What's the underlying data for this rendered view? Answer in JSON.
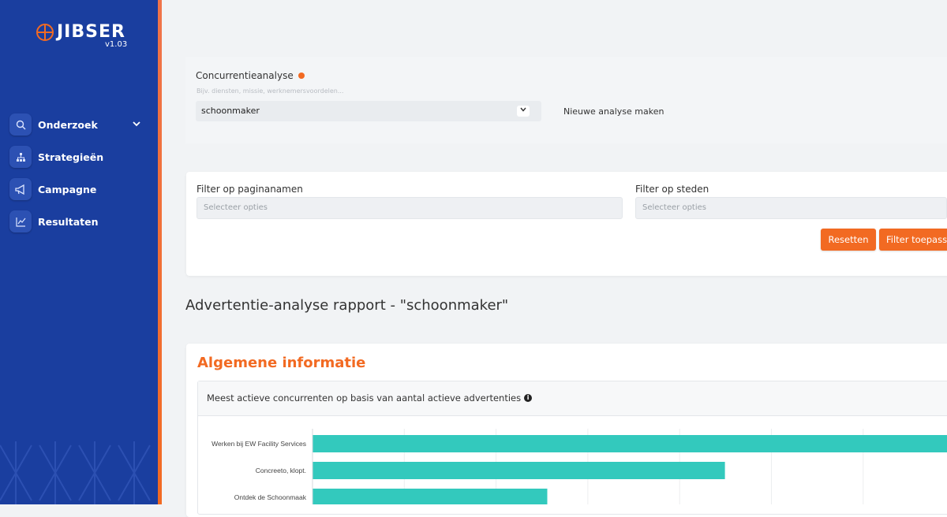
{
  "sidebar": {
    "logo_text": "JIBSER",
    "version": "v1.03",
    "items": [
      {
        "label": "Onderzoek",
        "icon": "search-icon"
      },
      {
        "label": "Strategieën",
        "icon": "sitemap-icon"
      },
      {
        "label": "Campagne",
        "icon": "megaphone-icon"
      },
      {
        "label": "Resultaten",
        "icon": "line-chart-icon"
      }
    ]
  },
  "analysis": {
    "label": "Concurrentieanalyse",
    "hint": "Bijv. diensten, missie, werknemersvoordelen...",
    "selected": "schoonmaker",
    "new_analysis": "Nieuwe analyse maken"
  },
  "filters": {
    "pages_label": "Filter op paginanamen",
    "pages_placeholder": "Selecteer opties",
    "cities_label": "Filter op steden",
    "cities_placeholder": "Selecteer opties",
    "reset_label": "Resetten",
    "apply_label": "Filter toepass"
  },
  "report": {
    "title": "Advertentie-analyse rapport - \"schoonmaker\"",
    "section_title": "Algemene informatie",
    "chart_title": "Meest actieve concurrenten op basis van aantal actieve advertenties"
  },
  "colors": {
    "sidebar": "#1a3e9f",
    "accent": "#f26a22",
    "bar": "#33c9bd"
  },
  "chart_data": {
    "type": "bar",
    "orientation": "horizontal",
    "categories": [
      "Werken bij EW Facility Services",
      "Concreeto, klopt.",
      "Ontdek de Schoonmaak"
    ],
    "values": [
      100,
      65,
      37
    ],
    "grid": true
  }
}
